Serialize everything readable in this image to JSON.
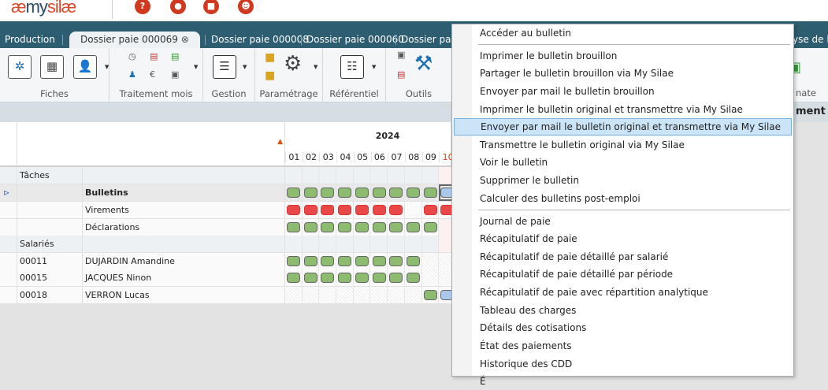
{
  "app": {
    "logo": "mysilae",
    "logo_prefix": "æ",
    "logo_text": "my",
    "logo_suffix": "silæ",
    "top_icons": [
      {
        "name": "help-icon",
        "glyph": "?"
      },
      {
        "name": "chat-icon",
        "glyph": "●"
      },
      {
        "name": "inbox-icon",
        "glyph": "■"
      },
      {
        "name": "users-icon",
        "glyph": "☻"
      }
    ]
  },
  "tabs": [
    {
      "label": "Production"
    },
    {
      "label": "Dossier paie 000069",
      "active": true
    },
    {
      "label": "Dossier paie 000008"
    },
    {
      "label": "Dossier paie 000060"
    },
    {
      "label": "Dossier paie"
    }
  ],
  "tab_right_partial": "yse de l'a",
  "ribbon": {
    "groups": [
      {
        "label": "Fiches"
      },
      {
        "label": "Traitement mois"
      },
      {
        "label": "Gestion"
      },
      {
        "label": "Paramétrage"
      },
      {
        "label": "Référentiel"
      },
      {
        "label": "Outils"
      }
    ],
    "right_partial_label": "nate"
  },
  "graybar_partial": "ment",
  "grid": {
    "year": "2024",
    "months": [
      "01",
      "02",
      "03",
      "04",
      "05",
      "06",
      "07",
      "08",
      "09",
      "10"
    ],
    "current_month": "10",
    "colors": {
      "green": "#8dbb70",
      "red": "#e84848",
      "blue": "#a9c8ea"
    },
    "rows": [
      {
        "type": "section",
        "c1": "Tâches",
        "c2": "",
        "status": [
          "",
          "",
          "",
          "",
          "",
          "",
          "",
          "",
          "",
          ""
        ]
      },
      {
        "type": "task",
        "c1": "",
        "c2": "Bulletins",
        "bold": true,
        "selected": true,
        "status": [
          "green",
          "green",
          "green",
          "green",
          "green",
          "green",
          "green",
          "green",
          "green",
          "blue"
        ]
      },
      {
        "type": "task",
        "c1": "",
        "c2": "Virements",
        "status": [
          "red",
          "red",
          "red",
          "red",
          "red",
          "red",
          "red",
          "",
          "red",
          "red"
        ]
      },
      {
        "type": "task",
        "c1": "",
        "c2": "Déclarations",
        "status": [
          "green",
          "green",
          "green",
          "green",
          "green",
          "green",
          "green",
          "green",
          "green",
          ""
        ]
      },
      {
        "type": "section",
        "c1": "Salariés",
        "c2": "",
        "status": [
          "",
          "",
          "",
          "",
          "",
          "",
          "",
          "",
          "",
          ""
        ]
      },
      {
        "type": "emp",
        "c1": "00011",
        "c2": "DUJARDIN Amandine",
        "status": [
          "green",
          "green",
          "green",
          "green",
          "green",
          "green",
          "green",
          "green",
          "hatch",
          "hatch"
        ]
      },
      {
        "type": "emp",
        "c1": "00015",
        "c2": "JACQUES Ninon",
        "status": [
          "green",
          "green",
          "green",
          "green",
          "green",
          "green",
          "green",
          "green",
          "hatch",
          "hatch"
        ]
      },
      {
        "type": "emp",
        "c1": "00018",
        "c2": "VERRON Lucas",
        "status": [
          "hatch",
          "hatch",
          "hatch",
          "hatch",
          "hatch",
          "hatch",
          "hatch",
          "hatch",
          "green",
          "blue"
        ]
      }
    ]
  },
  "context_menu": {
    "items": [
      {
        "label": "Accéder au bulletin",
        "sep_after": true
      },
      {
        "label": "Imprimer le bulletin brouillon"
      },
      {
        "label": "Partager le bulletin brouillon via My Silae"
      },
      {
        "label": "Envoyer par mail le bulletin brouillon"
      },
      {
        "label": "Imprimer le bulletin original et transmettre via My Silae"
      },
      {
        "label": "Envoyer par mail le bulletin original et transmettre via My Silae",
        "highlighted": true
      },
      {
        "label": "Transmettre le bulletin original via My Silae"
      },
      {
        "label": "Voir le bulletin"
      },
      {
        "label": "Supprimer le bulletin"
      },
      {
        "label": "Calculer des bulletins post-emploi",
        "sep_after": true
      },
      {
        "label": "Journal de paie"
      },
      {
        "label": "Récapitulatif de paie"
      },
      {
        "label": "Récapitulatif de paie détaillé par salarié"
      },
      {
        "label": "Récapitulatif de paie détaillé par période"
      },
      {
        "label": "Récapitulatif de paie avec répartition analytique"
      },
      {
        "label": "Tableau des charges"
      },
      {
        "label": "Détails des cotisations"
      },
      {
        "label": "État des paiements"
      },
      {
        "label": "Historique des CDD"
      },
      {
        "label": "É"
      }
    ]
  }
}
